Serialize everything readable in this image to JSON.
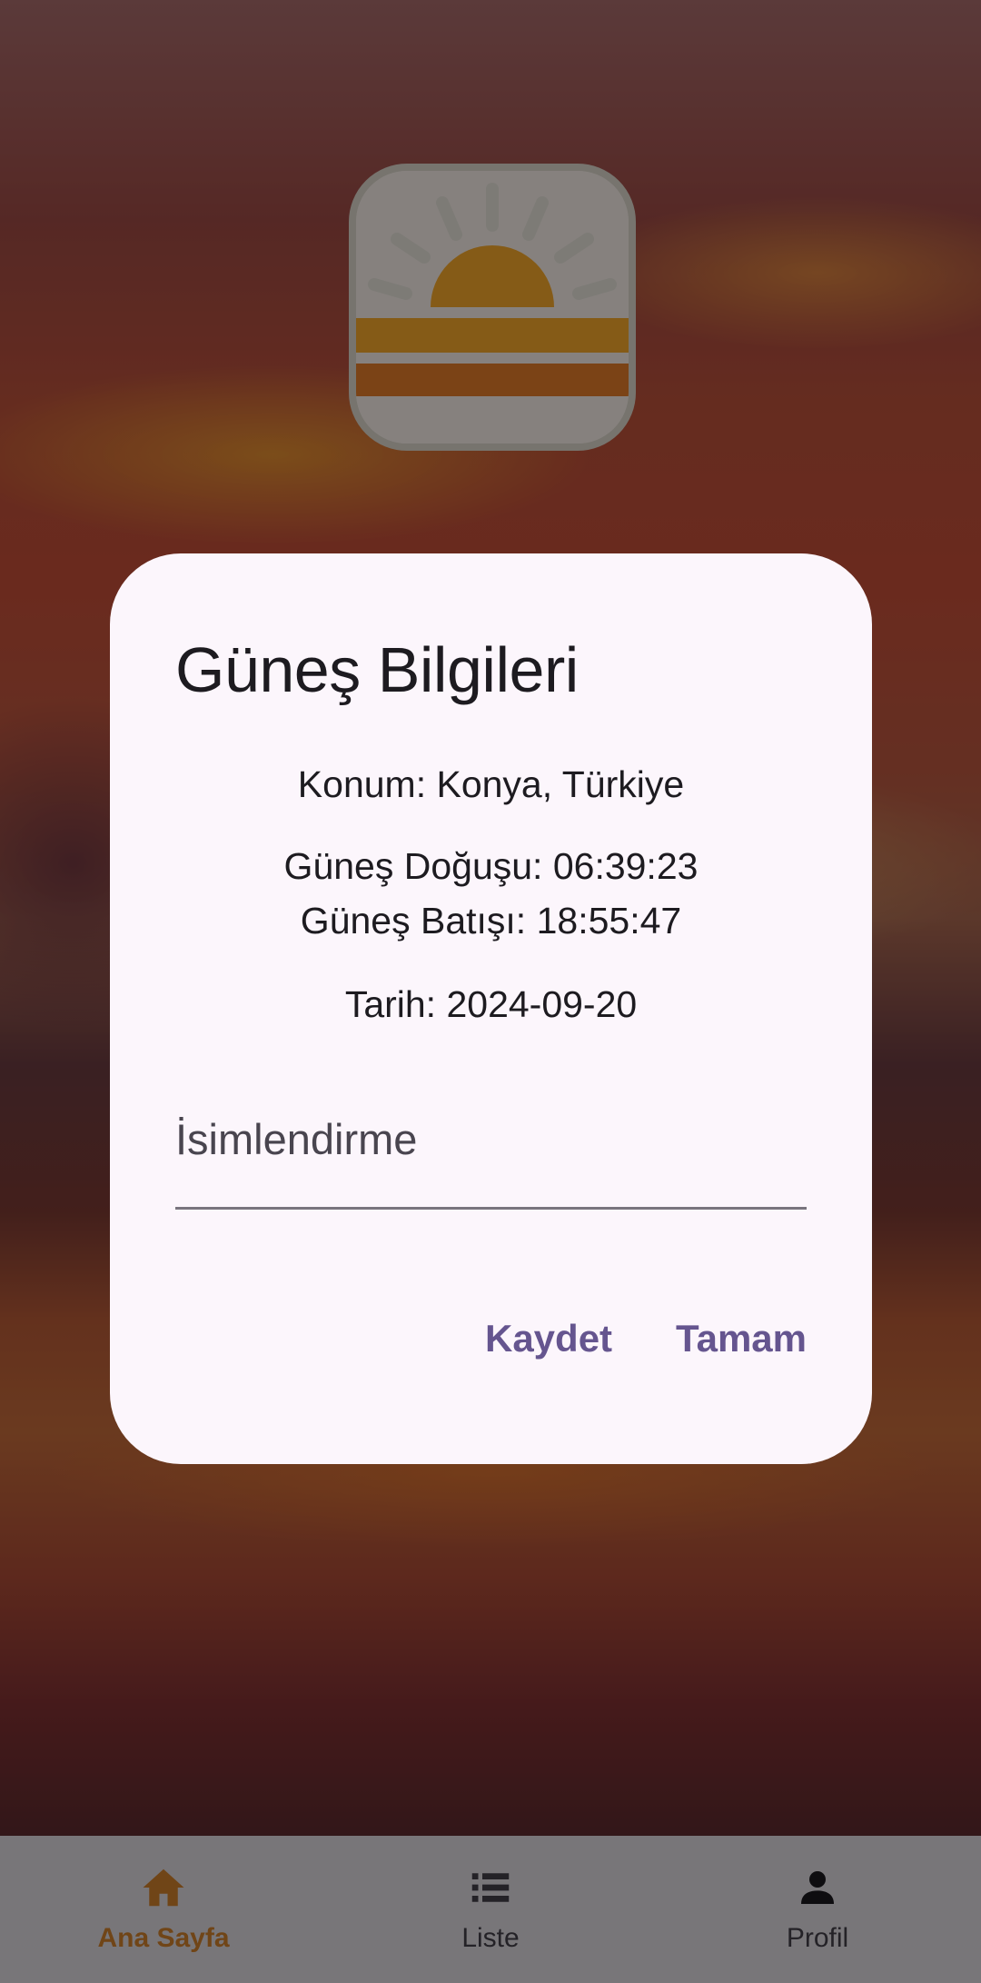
{
  "dialog": {
    "title": "Güneş Bilgileri",
    "location": "Konum: Konya, Türkiye",
    "sunrise": "Güneş Doğuşu: 06:39:23",
    "sunset": "Güneş Batışı: 18:55:47",
    "date": "Tarih: 2024-09-20",
    "name_field": {
      "placeholder": "İsimlendirme",
      "value": ""
    },
    "save_label": "Kaydet",
    "ok_label": "Tamam"
  },
  "bottom_nav": {
    "items": [
      {
        "label": "Ana Sayfa",
        "icon": "home-icon",
        "active": true
      },
      {
        "label": "Liste",
        "icon": "list-icon",
        "active": false
      },
      {
        "label": "Profil",
        "icon": "person-icon",
        "active": false
      }
    ]
  },
  "colors": {
    "accent": "#65558f",
    "nav_active": "#e08a2f",
    "dialog_bg": "#fcf6fc",
    "logo_sun": "#f2a62a"
  }
}
